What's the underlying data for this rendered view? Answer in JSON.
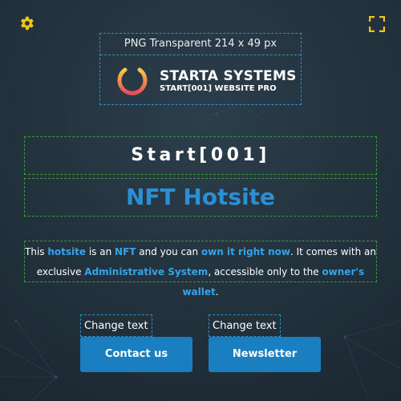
{
  "colors": {
    "accent": "#2a90d6",
    "highlight": "#35a3ea",
    "button": "#1a7fc0",
    "background": "#24343f",
    "icon": "#f2c318"
  },
  "toolbar": {
    "settings_icon": "gear-icon",
    "fullscreen_icon": "expand-icon"
  },
  "logo": {
    "caption": "PNG Transparent 214 x 49 px",
    "brand_name": "STARTA SYSTEMS",
    "brand_sub": "START[001] WEBSITE PRO",
    "icon": "power-icon"
  },
  "hero": {
    "title": "Start[001]",
    "headline": "NFT Hotsite"
  },
  "description": {
    "p1": "This ",
    "h1": "hotsite",
    "p2": " is an ",
    "h2": "NFT",
    "p3": " and you can ",
    "h3": "own it right now",
    "p4": ". It comes with an exclusive ",
    "h4": "Administrative System",
    "p5": ", accessible only to the ",
    "h5": "owner's wallet",
    "p6": "."
  },
  "actions": {
    "contact": {
      "change_label": "Change text",
      "button_label": "Contact us"
    },
    "newsletter": {
      "change_label": "Change text",
      "button_label": "Newsletter"
    }
  }
}
